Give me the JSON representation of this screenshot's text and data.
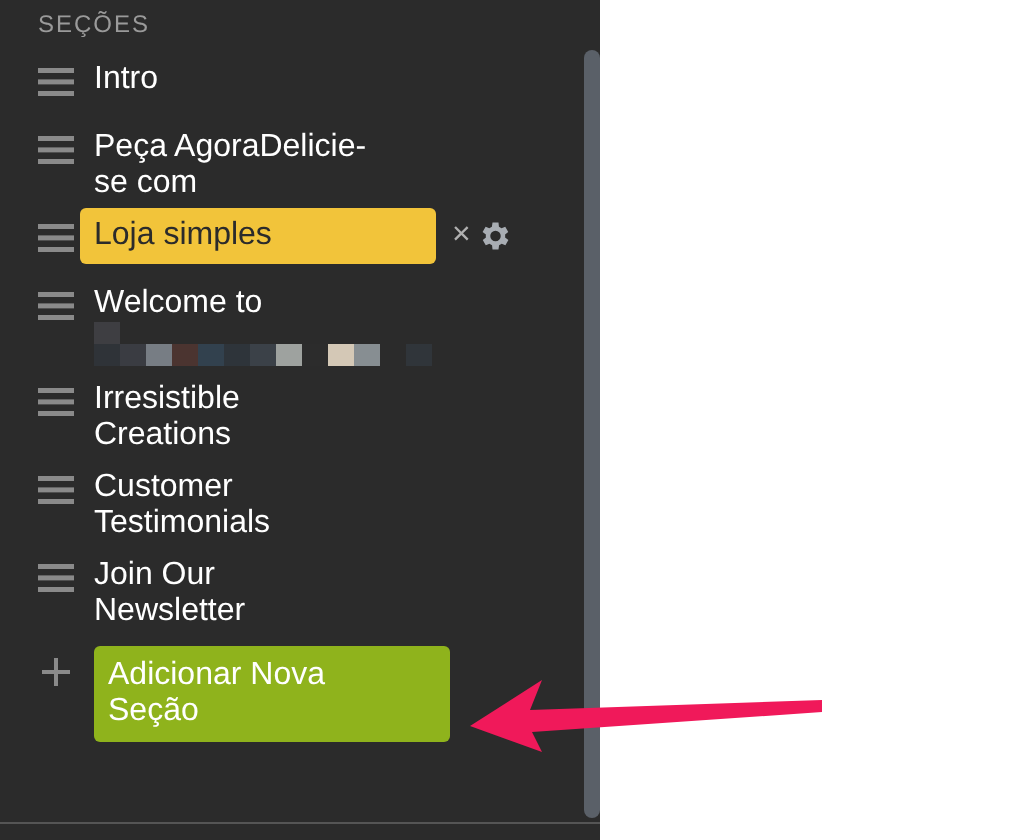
{
  "sidebar": {
    "heading": "SEÇÕES",
    "sections": [
      {
        "label": "Intro",
        "selected": false
      },
      {
        "label": "Peça AgoraDelicie-se com",
        "selected": false
      },
      {
        "label": "Loja simples",
        "selected": true
      },
      {
        "label": "Welcome to",
        "selected": false,
        "obscured": true
      },
      {
        "label": "Irresistible Creations",
        "selected": false
      },
      {
        "label": "Customer Testimonials",
        "selected": false
      },
      {
        "label": "Join Our Newsletter",
        "selected": false
      }
    ],
    "delete_glyph": "×",
    "add_button": {
      "label": "Adicionar Nova Seção"
    }
  }
}
